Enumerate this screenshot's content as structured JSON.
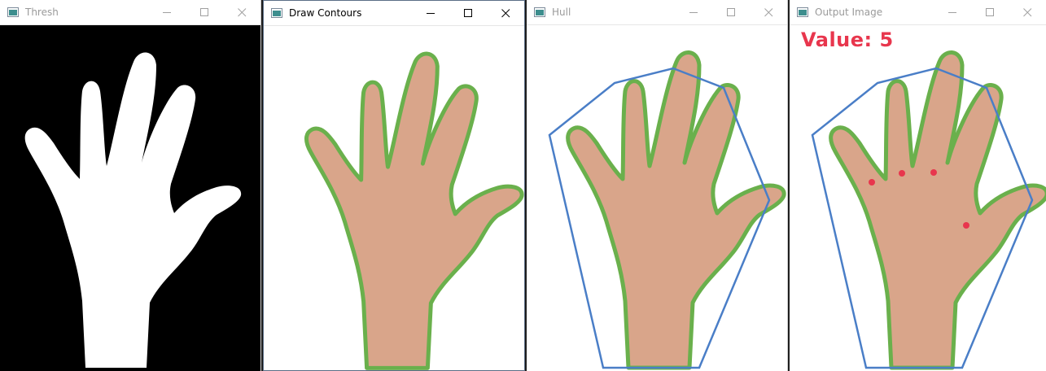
{
  "windows": [
    {
      "title": "Thresh",
      "active": false
    },
    {
      "title": "Draw Contours",
      "active": true
    },
    {
      "title": "Hull",
      "active": false
    },
    {
      "title": "Output Image",
      "active": false
    }
  ],
  "output": {
    "value_text": "Value:  5"
  },
  "icons": [
    "app-icon",
    "minimize-icon",
    "maximize-icon",
    "close-icon"
  ],
  "colors": {
    "contour": "#6ab04c",
    "hull": "#4a7ec7",
    "defect_points": "#e8364d",
    "value_text": "#e8364d",
    "thresh_background": "#000000",
    "thresh_mask": "#ffffff",
    "skin": "#d9a58a"
  }
}
